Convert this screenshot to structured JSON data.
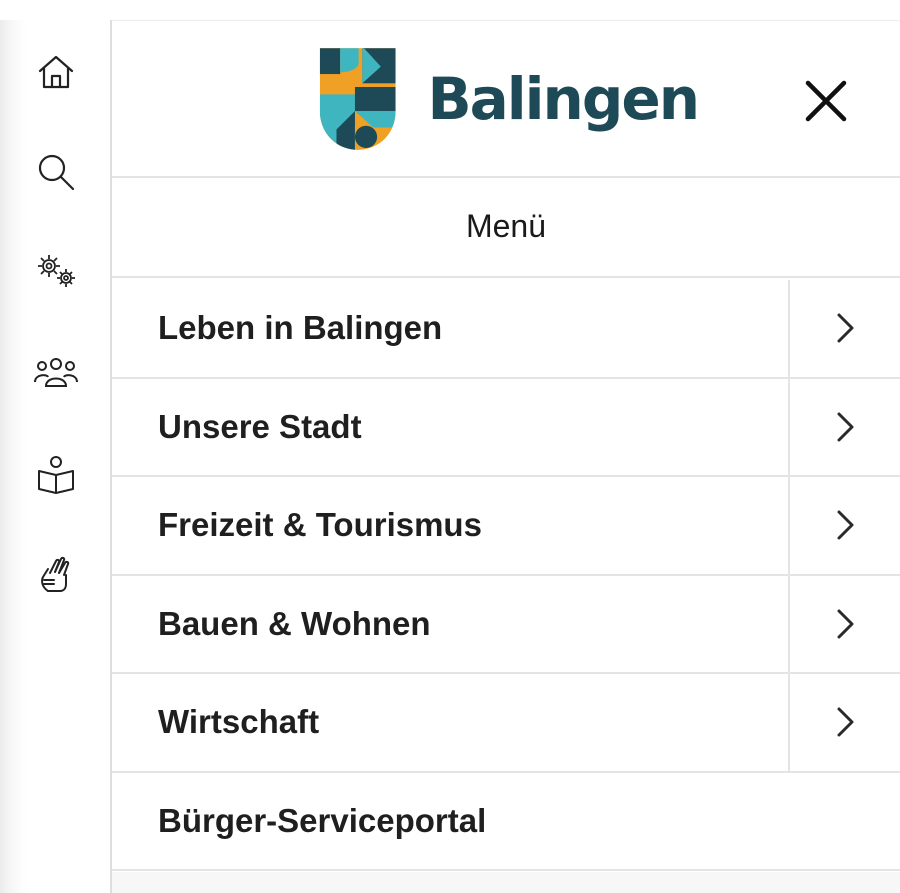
{
  "header": {
    "logo_text": "Balingen",
    "brand_colors": {
      "teal": "#1e4a57",
      "orange": "#f0a024",
      "cyan": "#3fb5c0",
      "dark": "#17414c"
    }
  },
  "rail": {
    "icons": [
      {
        "name": "home-icon"
      },
      {
        "name": "search-icon"
      },
      {
        "name": "gears-icon"
      },
      {
        "name": "people-icon"
      },
      {
        "name": "reading-person-icon"
      },
      {
        "name": "sign-language-icon"
      }
    ]
  },
  "menu": {
    "title": "Menü",
    "items": [
      {
        "label": "Leben in Balingen",
        "has_submenu": true
      },
      {
        "label": "Unsere Stadt",
        "has_submenu": true
      },
      {
        "label": "Freizeit & Tourismus",
        "has_submenu": true
      },
      {
        "label": "Bauen & Wohnen",
        "has_submenu": true
      },
      {
        "label": "Wirtschaft",
        "has_submenu": true
      },
      {
        "label": "Bürger-Serviceportal",
        "has_submenu": false
      }
    ]
  }
}
